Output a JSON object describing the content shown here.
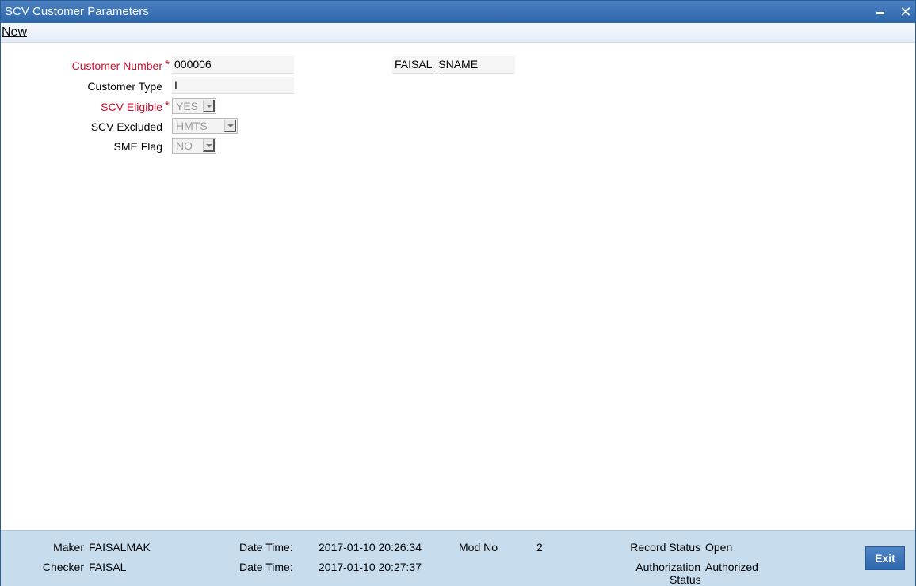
{
  "window": {
    "title": "SCV Customer Parameters"
  },
  "menu": {
    "new_label": "New"
  },
  "form": {
    "customer_number": {
      "label": "Customer Number",
      "value": "000006",
      "required": "*"
    },
    "customer_name": {
      "value": "FAISAL_SNAME"
    },
    "customer_type": {
      "label": "Customer Type",
      "value": "I"
    },
    "scv_eligible": {
      "label": "SCV Eligible",
      "value": "YES",
      "required": "*"
    },
    "scv_excluded": {
      "label": "SCV Excluded",
      "value": "HMTS"
    },
    "sme_flag": {
      "label": "SME Flag",
      "value": "NO"
    }
  },
  "footer": {
    "maker_label": "Maker",
    "maker_value": "FAISALMAK",
    "checker_label": "Checker",
    "checker_value": "FAISAL",
    "datetime_label_1": "Date Time:",
    "datetime_value_1": "2017-01-10 20:26:34",
    "datetime_label_2": "Date Time:",
    "datetime_value_2": "2017-01-10 20:27:37",
    "modno_label": "Mod No",
    "modno_value": "2",
    "record_status_label": "Record Status",
    "record_status_value": "Open",
    "auth_status_label_1": "Authorization",
    "auth_status_label_2": "Status",
    "auth_status_value": "Authorized",
    "exit_label": "Exit"
  },
  "colors": {
    "title_bar": "#2f67ad",
    "required": "#c8102e",
    "footer_bg": "#c7dced"
  }
}
